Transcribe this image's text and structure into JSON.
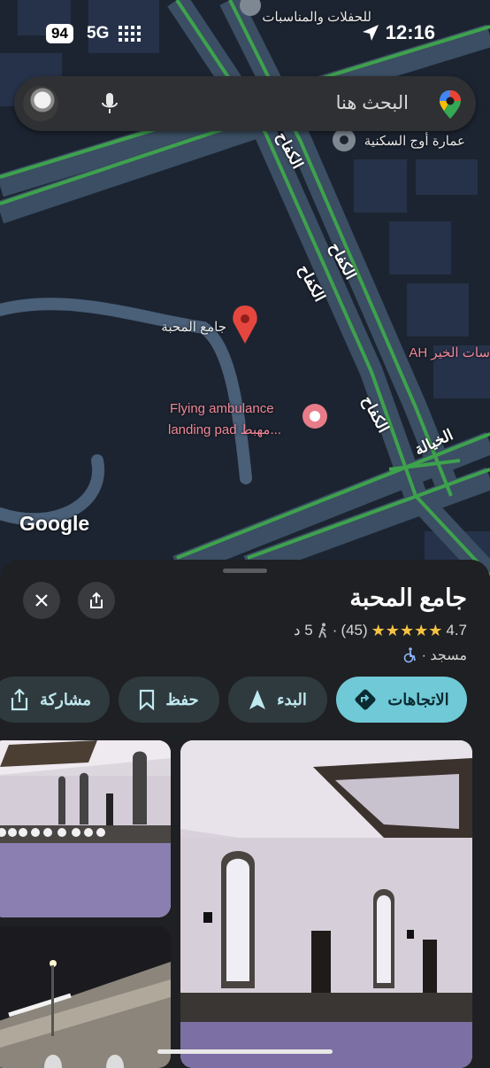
{
  "status_bar": {
    "battery": "94",
    "network": "5G",
    "time": "12:16"
  },
  "search": {
    "placeholder": "البحث هنا",
    "avatar_icon": "avatar",
    "mic_icon": "mic-icon",
    "logo_icon": "google-maps-pin-icon"
  },
  "map": {
    "labels": {
      "venue_top": "للحفلات والمناسبات",
      "residence": "عمارة أوج السكنية",
      "mosque": "جامع المحبة",
      "ambulance_line1": "Flying ambulance",
      "ambulance_line2": "landing pad مهبط...",
      "khair": "سات الخير AH",
      "road_1": "الكفاح",
      "road_2": "الكفاح",
      "road_3": "الكفاح",
      "road_4": "الكفاح",
      "road_5": "الخيالة"
    },
    "attribution": "Google",
    "colors": {
      "background": "#1c2431",
      "traffic": "#3ea24d",
      "road": "#3b4e63",
      "pin": "#e5473f"
    }
  },
  "place": {
    "title": "جامع المحبة",
    "rating": "4.7",
    "stars": "★★★★★",
    "reviews": "(45)",
    "separator": "·",
    "walk_time": "5 د",
    "category": "مسجد ·",
    "accessibility_icon": "wheelchair-icon"
  },
  "actions": {
    "directions": "الاتجاهات",
    "start": "البدء",
    "save": "حفظ",
    "share": "مشاركة"
  },
  "accent_colors": {
    "primary_chip": "#6fc9d7",
    "chip": "#2f3a3e",
    "sheet": "#1f2023"
  }
}
